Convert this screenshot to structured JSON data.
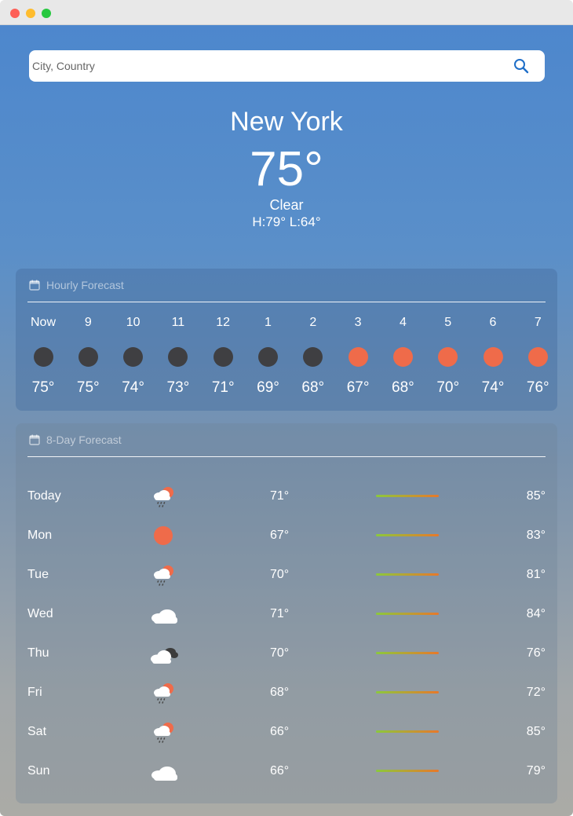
{
  "search": {
    "placeholder": "City, Country"
  },
  "current": {
    "city": "New York",
    "temp": "75°",
    "condition": "Clear",
    "hilo": "H:79° L:64°"
  },
  "hourly": {
    "title": "Hourly Forecast",
    "items": [
      {
        "label": "Now",
        "temp": "75°",
        "kind": "moon"
      },
      {
        "label": "9",
        "temp": "75°",
        "kind": "moon"
      },
      {
        "label": "10",
        "temp": "74°",
        "kind": "moon"
      },
      {
        "label": "11",
        "temp": "73°",
        "kind": "moon"
      },
      {
        "label": "12",
        "temp": "71°",
        "kind": "moon"
      },
      {
        "label": "1",
        "temp": "69°",
        "kind": "moon"
      },
      {
        "label": "2",
        "temp": "68°",
        "kind": "moon"
      },
      {
        "label": "3",
        "temp": "67°",
        "kind": "sun"
      },
      {
        "label": "4",
        "temp": "68°",
        "kind": "sun"
      },
      {
        "label": "5",
        "temp": "70°",
        "kind": "sun"
      },
      {
        "label": "6",
        "temp": "74°",
        "kind": "sun"
      },
      {
        "label": "7",
        "temp": "76°",
        "kind": "sun"
      }
    ]
  },
  "daily": {
    "title": "8-Day Forecast",
    "days": [
      {
        "day": "Today",
        "low": "71°",
        "high": "85°",
        "icon": "rain-sun-cloud-icon"
      },
      {
        "day": "Mon",
        "low": "67°",
        "high": "83°",
        "icon": "sun-icon"
      },
      {
        "day": "Tue",
        "low": "70°",
        "high": "81°",
        "icon": "rain-sun-cloud-icon"
      },
      {
        "day": "Wed",
        "low": "71°",
        "high": "84°",
        "icon": "cloud-icon"
      },
      {
        "day": "Thu",
        "low": "70°",
        "high": "76°",
        "icon": "dark-cloud-icon"
      },
      {
        "day": "Fri",
        "low": "68°",
        "high": "72°",
        "icon": "rain-sun-cloud-icon"
      },
      {
        "day": "Sat",
        "low": "66°",
        "high": "85°",
        "icon": "rain-sun-cloud-icon"
      },
      {
        "day": "Sun",
        "low": "66°",
        "high": "79°",
        "icon": "cloud-icon"
      }
    ]
  },
  "colors": {
    "moon": "#3f3f42",
    "sun": "#ef6b4a",
    "accent": "#1e6ec8"
  }
}
